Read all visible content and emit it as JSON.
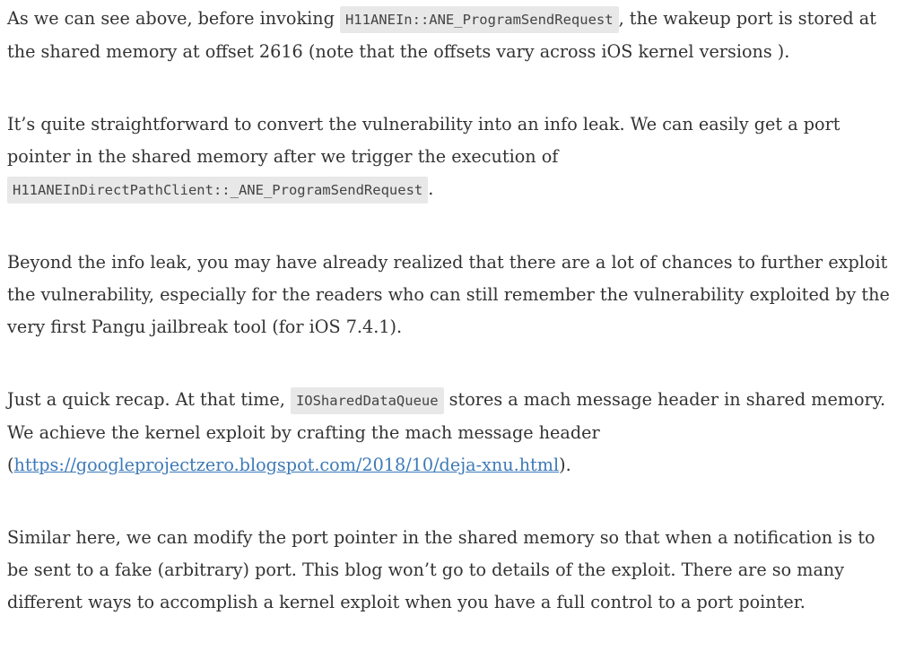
{
  "paragraphs": [
    {
      "before": "As we can see above, before invoking ",
      "code": "H11ANEIn::ANE_ProgramSendRequest",
      "after": ", the wakeup port is stored at the shared memory at offset 2616 (note that the offsets vary across iOS kernel versions )."
    },
    {
      "before": "It’s quite straightforward to convert the vulnerability into an info leak.  We can easily get a port pointer in the shared memory after we trigger the execution of ",
      "code": "H11ANEInDirectPathClient::_ANE_ProgramSendRequest",
      "after": "."
    },
    {
      "text": "Beyond the info leak, you may have already realized that there are a lot of chances to further exploit the vulnerability, especially for the readers who can still remember the vulnerability exploited by the very first Pangu jailbreak tool (for iOS 7.4.1)."
    },
    {
      "before": "Just a quick recap. At that time, ",
      "code": "IOSharedDataQueue",
      "middle": " stores a mach message header in shared memory. We achieve the kernel exploit by crafting the mach message header (",
      "link": "https://googleprojectzero.blogspot.com/2018/10/deja-xnu.html",
      "after": ")."
    },
    {
      "text": "Similar here, we can modify the port pointer in the shared memory so that when a notification is to be sent to a fake (arbitrary) port. This blog won’t go to details of the exploit. There are so many different ways to accomplish a kernel exploit when you have a full control to a port pointer."
    }
  ]
}
